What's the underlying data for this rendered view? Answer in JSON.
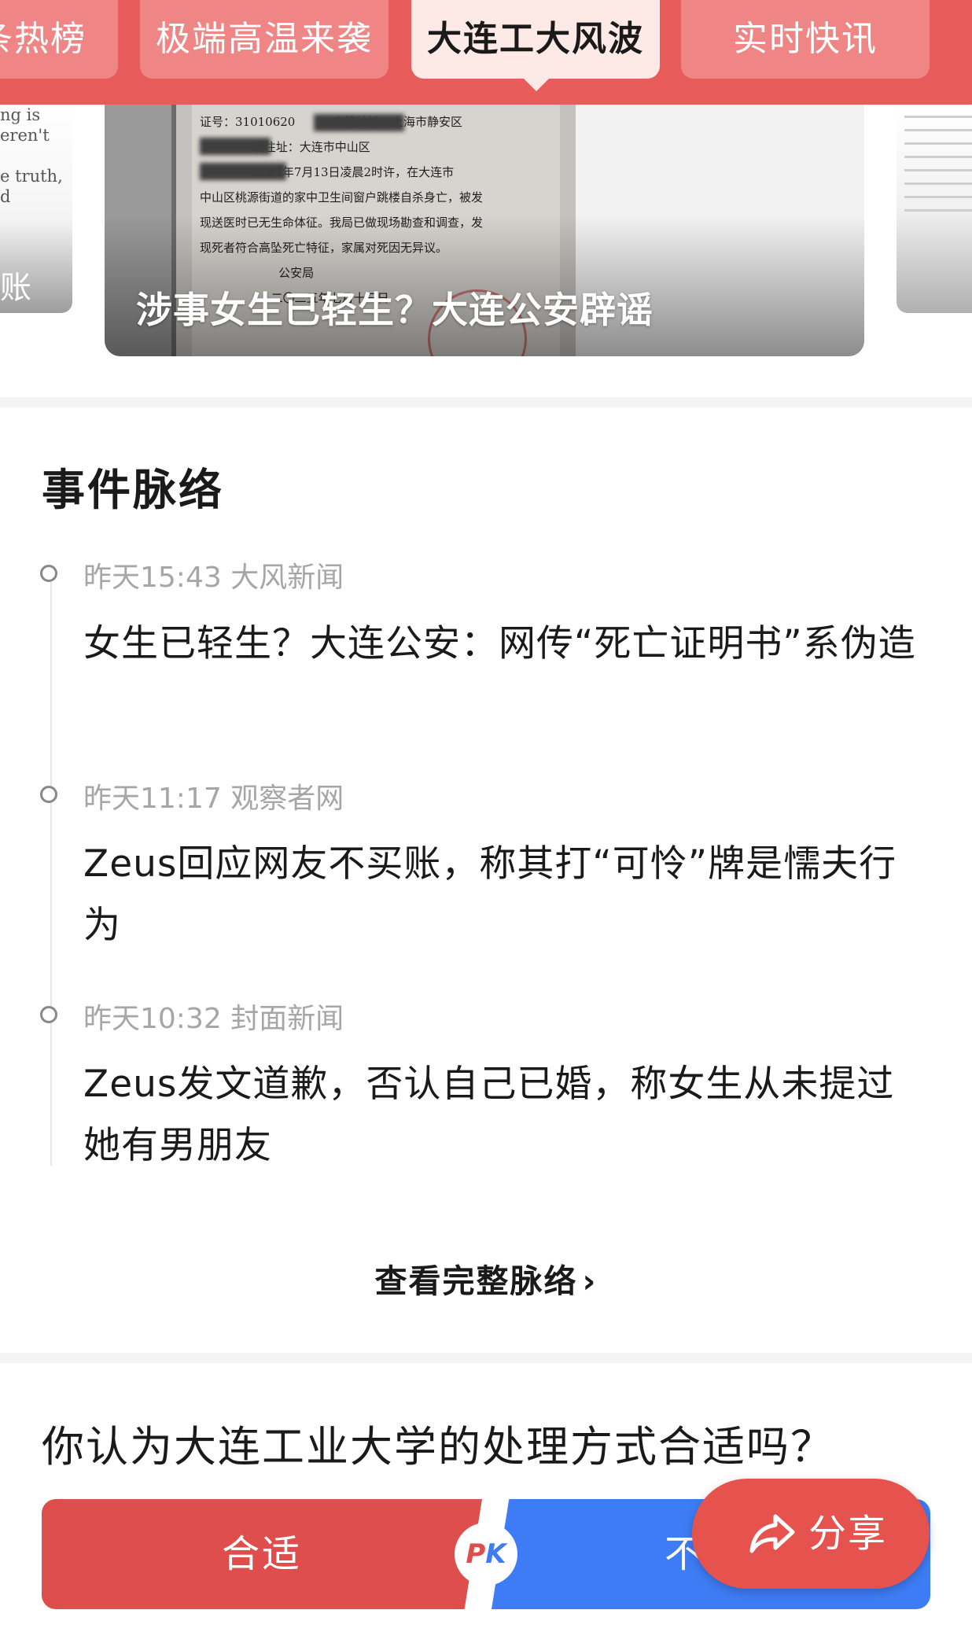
{
  "tabs": [
    {
      "label": "条热榜"
    },
    {
      "label": "极端高温来袭"
    },
    {
      "label": "大连工大风波"
    },
    {
      "label": "实时快讯"
    }
  ],
  "carousel": {
    "main_title": "涉事女生已轻生？大连公安辟谣",
    "left_fragment": "ng is\neren't\n\ne truth,\nd",
    "left_fragment_bottom": "账",
    "document_text": "证号：31010620          户籍地址：上海市静安区\n              现住址：大连市中山区\n              2025年7月13日凌晨2时许，在大连市\n中山区桃源街道的家中卫生间窗户跳楼自杀身亡，被发\n现送医时已无生命体征。我局已做现场勘查和调查，发\n现死者符合高坠死亡特征，家属对死因无异议。\n                     公安局\n                   二〇二五年七月十三日"
  },
  "timeline": {
    "section_title": "事件脉络",
    "items": [
      {
        "meta": "昨天15:43 大风新闻",
        "headline": "女生已轻生？大连公安：网传“死亡证明书”系伪造"
      },
      {
        "meta": "昨天11:17 观察者网",
        "headline": "Zeus回应网友不买账，称其打“可怜”牌是懦夫行为"
      },
      {
        "meta": "昨天10:32 封面新闻",
        "headline": "Zeus发文道歉，否认自己已婚，称女生从未提过她有男朋友"
      }
    ],
    "view_more": "查看完整脉络",
    "view_more_icon": "chevron-right-icon"
  },
  "poll": {
    "question": "你认为大连工业大学的处理方式合适吗？",
    "yes_label": "合适",
    "no_label": "不",
    "pk_p": "P",
    "pk_k": "K"
  },
  "share": {
    "label": "分享",
    "icon": "share-arrow-icon"
  },
  "colors": {
    "brand_red": "#e85c5c",
    "yes_red": "#dd4e4c",
    "no_blue": "#3e7cf5"
  }
}
